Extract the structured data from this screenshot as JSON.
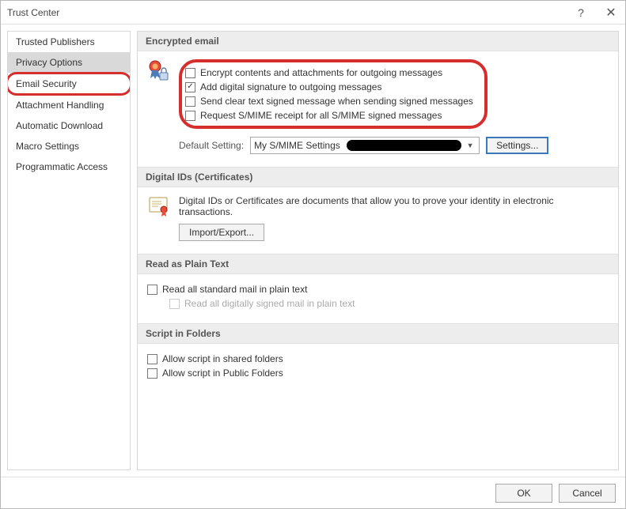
{
  "window": {
    "title": "Trust Center"
  },
  "sidebar": {
    "items": [
      {
        "label": "Trusted Publishers"
      },
      {
        "label": "Privacy Options"
      },
      {
        "label": "Email Security"
      },
      {
        "label": "Attachment Handling"
      },
      {
        "label": "Automatic Download"
      },
      {
        "label": "Macro Settings"
      },
      {
        "label": "Programmatic Access"
      }
    ]
  },
  "sections": {
    "encrypted": {
      "title": "Encrypted email",
      "opts": {
        "encrypt": "Encrypt contents and attachments for outgoing messages",
        "sign": "Add digital signature to outgoing messages",
        "cleartext": "Send clear text signed message when sending signed messages",
        "receipt": "Request S/MIME receipt for all S/MIME signed messages"
      },
      "default_label": "Default Setting:",
      "default_value": "My S/MIME Settings",
      "settings_btn": "Settings..."
    },
    "digital": {
      "title": "Digital IDs (Certificates)",
      "desc": "Digital IDs or Certificates are documents that allow you to prove your identity in electronic transactions.",
      "import_btn": "Import/Export..."
    },
    "plaintext": {
      "title": "Read as Plain Text",
      "opt1": "Read all standard mail in plain text",
      "opt2": "Read all digitally signed mail in plain text"
    },
    "script": {
      "title": "Script in Folders",
      "opt1": "Allow script in shared folders",
      "opt2": "Allow script in Public Folders"
    }
  },
  "footer": {
    "ok": "OK",
    "cancel": "Cancel"
  }
}
